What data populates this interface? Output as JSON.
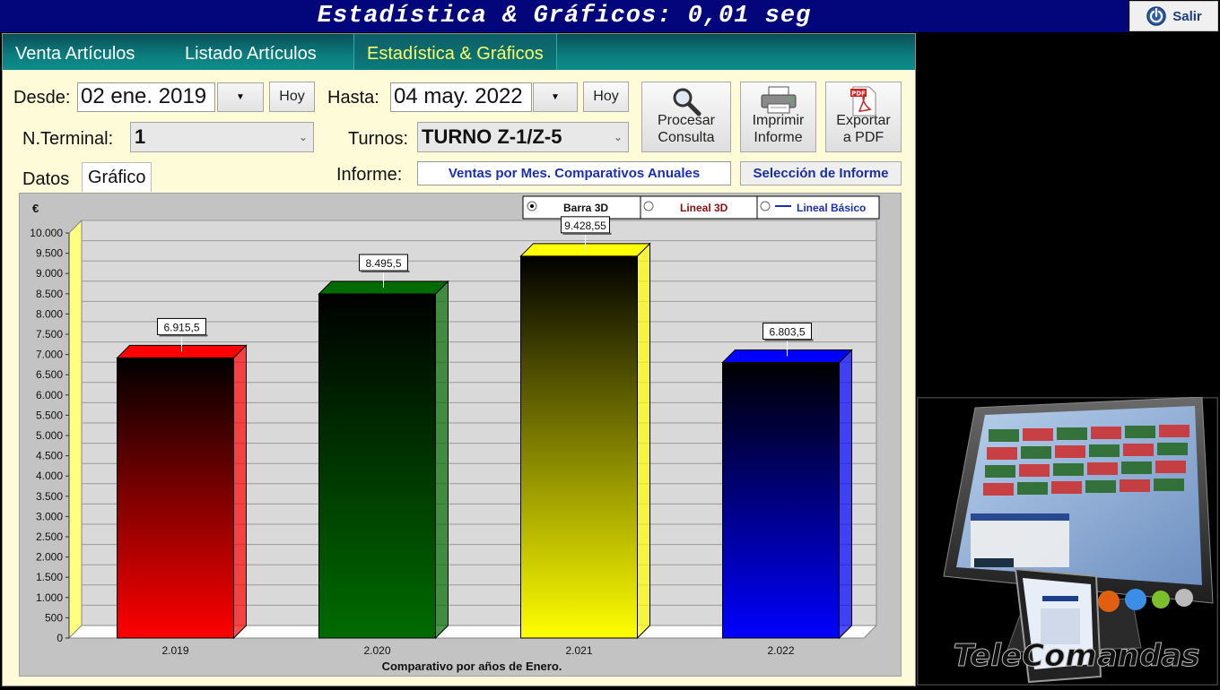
{
  "title": "Estadística & Gráficos: 0,01 seg",
  "exit_label": "Salir",
  "tabs": [
    "Venta Artículos",
    "Listado Artículos",
    "Estadística & Gráficos"
  ],
  "filters": {
    "desde_label": "Desde:",
    "desde_value": "02 ene. 2019",
    "hasta_label": "Hasta:",
    "hasta_value": "04 may. 2022",
    "hoy_label": "Hoy",
    "terminal_label": "N.Terminal:",
    "terminal_value": "1",
    "turnos_label": "Turnos:",
    "turnos_value": "TURNO Z-1/Z-5",
    "informe_label": "Informe:",
    "informe_value": "Ventas por Mes. Comparativos Anuales",
    "seleccion_label": "Selección de Informe"
  },
  "actions": {
    "procesar": [
      "Procesar",
      "Consulta"
    ],
    "imprimir": [
      "Imprimir",
      "Informe"
    ],
    "exportar": [
      "Exportar",
      "a PDF"
    ],
    "pdf_badge": "PDF"
  },
  "subtabs": [
    "Datos",
    "Gráfico"
  ],
  "chart_options": [
    "Barra 3D",
    "Lineal 3D",
    "Lineal Básico"
  ],
  "chart_data": {
    "type": "bar",
    "style": "3d",
    "unit_label": "€",
    "xlabel": "Comparativo por años de Enero.",
    "categories": [
      "2.019",
      "2.020",
      "2.021",
      "2.022"
    ],
    "values": [
      6915.5,
      8495.5,
      9428.55,
      6803.5
    ],
    "value_labels": [
      "6.915,5",
      "8.495,5",
      "9.428,55",
      "6.803,5"
    ],
    "colors": [
      "#ff0000",
      "#006b00",
      "#ffff00",
      "#0000ff"
    ],
    "ylim": [
      0,
      10000
    ],
    "ytick_step": 500,
    "ytick_labels": [
      "0",
      "500",
      "1.000",
      "1.500",
      "2.000",
      "2.500",
      "3.000",
      "3.500",
      "4.000",
      "4.500",
      "5.000",
      "5.500",
      "6.000",
      "6.500",
      "7.000",
      "7.500",
      "8.000",
      "8.500",
      "9.000",
      "9.500",
      "10.000"
    ],
    "grid": true,
    "legend": "none"
  },
  "brand_text": "TeleComandas"
}
